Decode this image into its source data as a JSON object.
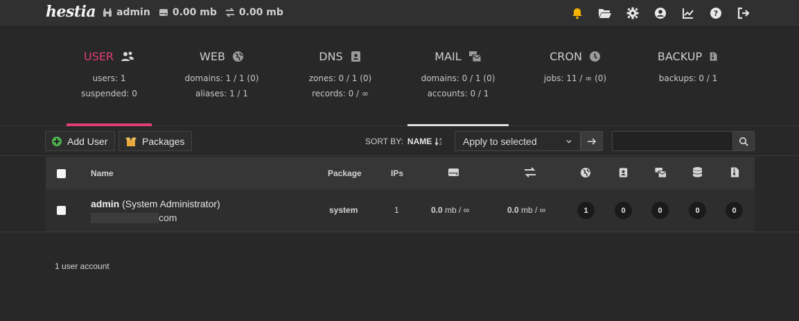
{
  "app": {
    "logo_text": "hestia"
  },
  "topbar": {
    "user": "admin",
    "disk": "0.00 mb",
    "bandwidth": "0.00 mb",
    "icons": [
      "bell-icon",
      "folder-open-icon",
      "gear-icon",
      "user-circle-icon",
      "chart-line-icon",
      "question-circle-icon",
      "sign-out-icon"
    ],
    "colors": {
      "bell": "#f5b400"
    }
  },
  "tabs": [
    {
      "title": "USER",
      "icon": "users-icon",
      "stat1": "users: 1",
      "stat2": "suspended: 0",
      "active": true
    },
    {
      "title": "WEB",
      "icon": "globe-icon",
      "stat1": "domains: 1 / 1 (0)",
      "stat2": "aliases: 1 / 1"
    },
    {
      "title": "DNS",
      "icon": "address-book-icon",
      "stat1": "zones: 0 / 1 (0)",
      "stat2": "records: 0 / ∞"
    },
    {
      "title": "MAIL",
      "icon": "mail-bulk-icon",
      "stat1": "domains: 0 / 1 (0)",
      "stat2": "accounts: 0 / 1"
    },
    {
      "title": "CRON",
      "icon": "clock-icon",
      "stat1": "jobs: 11 / ∞ (0)",
      "stat2": ""
    },
    {
      "title": "BACKUP",
      "icon": "file-archive-icon",
      "stat1": "backups: 0 / 1",
      "stat2": ""
    }
  ],
  "colors": {
    "accent_user": "#e13e73",
    "accent_green": "#4caf50",
    "mail_underline": "#e0e0e0"
  },
  "toolbar": {
    "add_user_label": "Add User",
    "packages_label": "Packages",
    "sort_by_label": "SORT BY:",
    "sort_by_value": "NAME",
    "apply_select_value": "Apply to selected",
    "search_placeholder": ""
  },
  "table": {
    "headers": {
      "name": "Name",
      "package": "Package",
      "ips": "IPs"
    },
    "header_icons": [
      "hard-drive-icon",
      "exchange-icon",
      "globe-icon",
      "address-book-icon",
      "mail-bulk-icon",
      "database-icon",
      "file-archive-icon"
    ],
    "rows": [
      {
        "username": "admin",
        "fullname": "(System Administrator)",
        "email_suffix": "com",
        "package": "system",
        "ips": "1",
        "disk_value": "0.0",
        "disk_unit": "mb / ∞",
        "bw_value": "0.0",
        "bw_unit": "mb / ∞",
        "web": "1",
        "dns": "0",
        "mail": "0",
        "db": "0",
        "backups": "0"
      }
    ]
  },
  "footer": {
    "count_text": "1 user account"
  }
}
